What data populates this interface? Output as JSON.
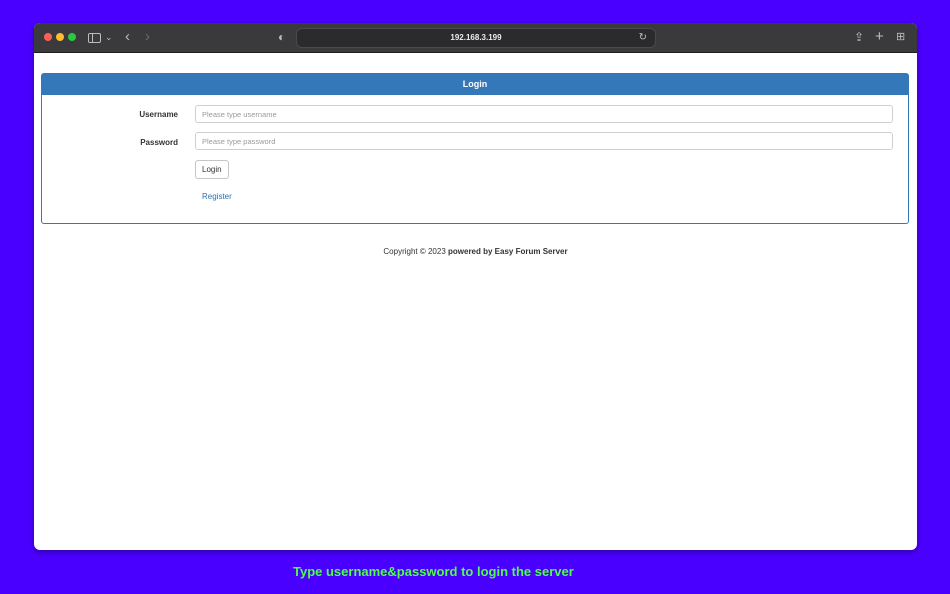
{
  "browser": {
    "url": "192.168.3.199",
    "icons": {
      "sidebar_toggle": "sidebar-icon",
      "back": "chevron-left-icon",
      "forward": "chevron-right-icon",
      "privacy": "shield-icon",
      "reload": "reload-icon",
      "share": "share-icon",
      "new_tab": "plus-icon",
      "tab_overview": "grid-icon"
    }
  },
  "login_panel": {
    "title": "Login",
    "username_label": "Username",
    "username_placeholder": "Please type username",
    "username_value": "",
    "password_label": "Password",
    "password_placeholder": "Please type password",
    "password_value": "",
    "login_button": "Login",
    "register_link": "Register"
  },
  "footer": {
    "copyright": "Copyright © 2023",
    "powered_by": "powered by Easy Forum Server"
  },
  "caption": "Type username&password to login the server",
  "colors": {
    "background": "#4a00ff",
    "panel_accent": "#3478b9",
    "link": "#2e6fad",
    "caption": "#4cff4c"
  }
}
